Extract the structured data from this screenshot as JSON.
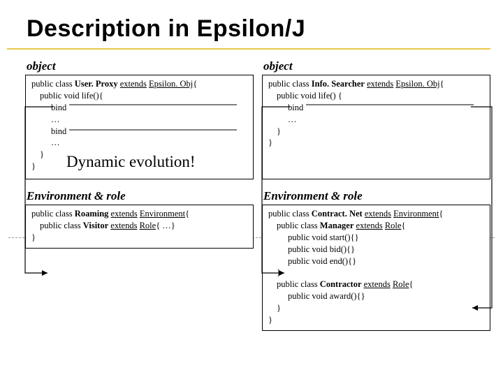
{
  "title": "Description in Epsilon/J",
  "labels": {
    "object": "object",
    "env_role": "Environment & role"
  },
  "left": {
    "obj": {
      "l1a": "public class ",
      "l1b": "User. Proxy",
      "l1c": " ",
      "l1d": "extends",
      "l1e": " ",
      "l1f": "Epsilon. Obj",
      "l1g": "{",
      "l2": "public void life(){",
      "l3": "bind",
      "l4": "…",
      "l5": "bind",
      "l6": "…",
      "l7": "}",
      "l8": "}",
      "dyn": "Dynamic evolution!"
    },
    "env": {
      "l1a": "public class ",
      "l1b": "Roaming",
      "l1c": " ",
      "l1d": "extends",
      "l1e": " ",
      "l1f": "Environment",
      "l1g": "{",
      "l2a": "public class ",
      "l2b": "Visitor",
      "l2c": " ",
      "l2d": "extends",
      "l2e": " ",
      "l2f": "Role",
      "l2g": "{  …}",
      "l3": "}"
    }
  },
  "right": {
    "obj": {
      "l1a": "public class ",
      "l1b": "Info. Searcher",
      "l1c": " ",
      "l1d": "extends",
      "l1e": " ",
      "l1f": "Epsilon. Obj",
      "l1g": "{",
      "l2": "public void life() {",
      "l3": "bind",
      "l4": "…",
      "l5": "}",
      "l6": "}"
    },
    "env": {
      "l1a": "public class ",
      "l1b": "Contract. Net",
      "l1c": " ",
      "l1d": "extends",
      "l1e": " ",
      "l1f": "Environment",
      "l1g": "{",
      "l2a": "public class ",
      "l2b": "Manager",
      "l2c": " ",
      "l2d": "extends",
      "l2e": " ",
      "l2f": "Role",
      "l2g": "{",
      "l3": "public void start(){}",
      "l4": "public void bid(){}",
      "l5": "public void end(){}",
      "l6": "}",
      "l7a": "public class ",
      "l7b": "Contractor",
      "l7c": " ",
      "l7d": "extends",
      "l7e": " ",
      "l7f": "Role",
      "l7g": "{",
      "l8": "public void award(){}",
      "l9": "}",
      "l10": "}"
    }
  }
}
